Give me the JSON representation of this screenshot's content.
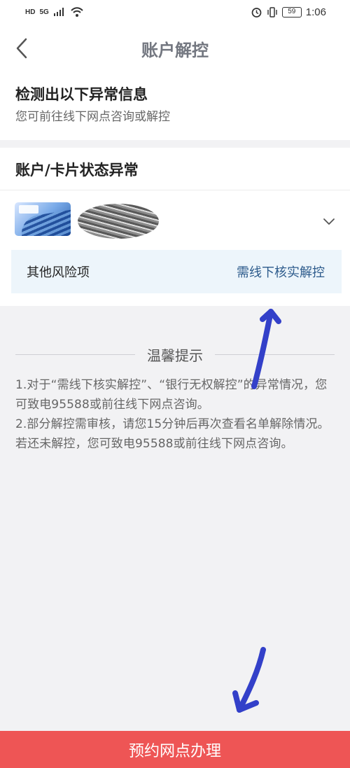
{
  "status_bar": {
    "left_badge": "HD",
    "network": "5G",
    "battery": "59",
    "time": "1:06"
  },
  "header": {
    "title": "账户解控"
  },
  "warning": {
    "title": "检测出以下异常信息",
    "subtitle": "您可前往线下网点咨询或解控"
  },
  "account_status": {
    "title": "账户/卡片状态异常",
    "risk_label": "其他风险项",
    "risk_action": "需线下核实解控"
  },
  "tips": {
    "heading": "温馨提示",
    "line_1": "1.对于“需线下核实解控”、“银行无权解控”的异常情况，您可致电95588或前往线下网点咨询。",
    "line_2": "2.部分解控需审核，请您15分钟后再次查看名单解除情况。若还未解控，您可致电95588或前往线下网点咨询。"
  },
  "bottom_action": {
    "label": "预约网点办理"
  },
  "icons": {
    "back": "chevron-left-icon",
    "expand": "chevron-down-icon"
  },
  "colors": {
    "accent": "#ee5555",
    "link": "#2d5b8c",
    "annotation": "#3340c9"
  }
}
